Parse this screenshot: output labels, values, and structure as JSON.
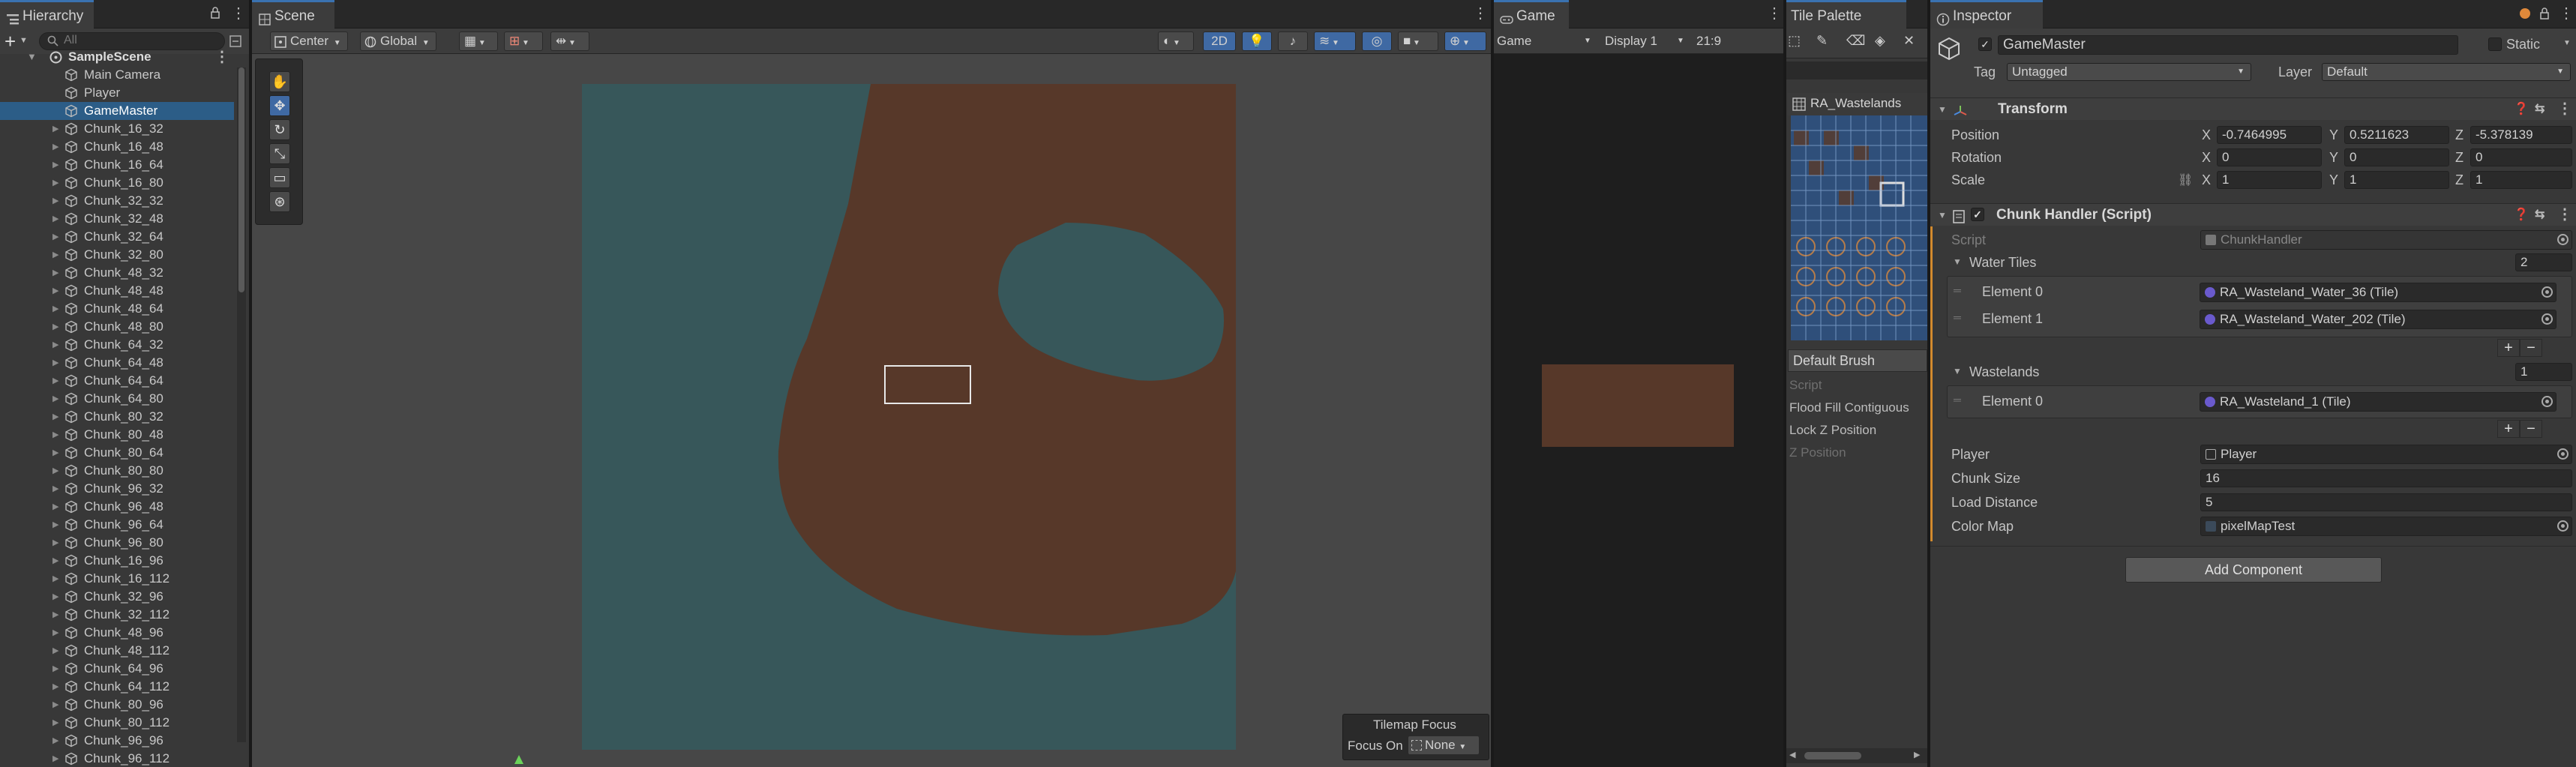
{
  "colors": {
    "accent": "#3f69a3",
    "land": "#573829",
    "water": "#37575a"
  },
  "hierarchy": {
    "tab": "Hierarchy",
    "search_placeholder": "All",
    "scene": "SampleScene",
    "items": [
      {
        "label": "Main Camera",
        "selected": false,
        "arrow": false
      },
      {
        "label": "Player",
        "selected": false,
        "arrow": false
      },
      {
        "label": "GameMaster",
        "selected": true,
        "arrow": false
      },
      {
        "label": "Chunk_16_32",
        "selected": false,
        "arrow": true
      },
      {
        "label": "Chunk_16_48",
        "selected": false,
        "arrow": true
      },
      {
        "label": "Chunk_16_64",
        "selected": false,
        "arrow": true
      },
      {
        "label": "Chunk_16_80",
        "selected": false,
        "arrow": true
      },
      {
        "label": "Chunk_32_32",
        "selected": false,
        "arrow": true
      },
      {
        "label": "Chunk_32_48",
        "selected": false,
        "arrow": true
      },
      {
        "label": "Chunk_32_64",
        "selected": false,
        "arrow": true
      },
      {
        "label": "Chunk_32_80",
        "selected": false,
        "arrow": true
      },
      {
        "label": "Chunk_48_32",
        "selected": false,
        "arrow": true
      },
      {
        "label": "Chunk_48_48",
        "selected": false,
        "arrow": true
      },
      {
        "label": "Chunk_48_64",
        "selected": false,
        "arrow": true
      },
      {
        "label": "Chunk_48_80",
        "selected": false,
        "arrow": true
      },
      {
        "label": "Chunk_64_32",
        "selected": false,
        "arrow": true
      },
      {
        "label": "Chunk_64_48",
        "selected": false,
        "arrow": true
      },
      {
        "label": "Chunk_64_64",
        "selected": false,
        "arrow": true
      },
      {
        "label": "Chunk_64_80",
        "selected": false,
        "arrow": true
      },
      {
        "label": "Chunk_80_32",
        "selected": false,
        "arrow": true
      },
      {
        "label": "Chunk_80_48",
        "selected": false,
        "arrow": true
      },
      {
        "label": "Chunk_80_64",
        "selected": false,
        "arrow": true
      },
      {
        "label": "Chunk_80_80",
        "selected": false,
        "arrow": true
      },
      {
        "label": "Chunk_96_32",
        "selected": false,
        "arrow": true
      },
      {
        "label": "Chunk_96_48",
        "selected": false,
        "arrow": true
      },
      {
        "label": "Chunk_96_64",
        "selected": false,
        "arrow": true
      },
      {
        "label": "Chunk_96_80",
        "selected": false,
        "arrow": true
      },
      {
        "label": "Chunk_16_96",
        "selected": false,
        "arrow": true
      },
      {
        "label": "Chunk_16_112",
        "selected": false,
        "arrow": true
      },
      {
        "label": "Chunk_32_96",
        "selected": false,
        "arrow": true
      },
      {
        "label": "Chunk_32_112",
        "selected": false,
        "arrow": true
      },
      {
        "label": "Chunk_48_96",
        "selected": false,
        "arrow": true
      },
      {
        "label": "Chunk_48_112",
        "selected": false,
        "arrow": true
      },
      {
        "label": "Chunk_64_96",
        "selected": false,
        "arrow": true
      },
      {
        "label": "Chunk_64_112",
        "selected": false,
        "arrow": true
      },
      {
        "label": "Chunk_80_96",
        "selected": false,
        "arrow": true
      },
      {
        "label": "Chunk_80_112",
        "selected": false,
        "arrow": true
      },
      {
        "label": "Chunk_96_96",
        "selected": false,
        "arrow": true
      },
      {
        "label": "Chunk_96_112",
        "selected": false,
        "arrow": true
      }
    ]
  },
  "scene": {
    "tab": "Scene",
    "pivot": "Center",
    "space": "Global",
    "mode_2d": "2D",
    "tilemap_focus": {
      "title": "Tilemap Focus",
      "label": "Focus On",
      "value": "None"
    }
  },
  "game": {
    "tab": "Game",
    "view": "Game",
    "display": "Display 1",
    "aspect": "21:9"
  },
  "palette": {
    "tab": "Tile Palette",
    "palette_name": "RA_Wastelands",
    "brush": "Default Brush",
    "options": [
      {
        "label": "Script",
        "dim": true
      },
      {
        "label": "Flood Fill Contiguous",
        "dim": false
      },
      {
        "label": "Lock Z Position",
        "dim": false
      },
      {
        "label": "Z Position",
        "dim": true
      }
    ]
  },
  "inspector": {
    "tab": "Inspector",
    "object_name": "GameMaster",
    "static_label": "Static",
    "tag_label": "Tag",
    "tag_value": "Untagged",
    "layer_label": "Layer",
    "layer_value": "Default",
    "transform": {
      "title": "Transform",
      "position_label": "Position",
      "position": [
        "-0.7464995",
        "0.5211623",
        "-5.378139"
      ],
      "rotation_label": "Rotation",
      "rotation": [
        "0",
        "0",
        "0"
      ],
      "scale_label": "Scale",
      "scale": [
        "1",
        "1",
        "1"
      ],
      "axis": [
        "X",
        "Y",
        "Z"
      ]
    },
    "chunk_handler": {
      "title": "Chunk Handler (Script)",
      "script_label": "Script",
      "script_value": "ChunkHandler",
      "water_label": "Water Tiles",
      "water_count": "2",
      "water_elements": [
        {
          "label": "Element 0",
          "value": "RA_Wasteland_Water_36 (Tile)"
        },
        {
          "label": "Element 1",
          "value": "RA_Wasteland_Water_202 (Tile)"
        }
      ],
      "wastelands_label": "Wastelands",
      "wastelands_count": "1",
      "wasteland_elements": [
        {
          "label": "Element 0",
          "value": "RA_Wasteland_1 (Tile)"
        }
      ],
      "player_label": "Player",
      "player_value": "Player",
      "chunk_size_label": "Chunk Size",
      "chunk_size": "16",
      "load_distance_label": "Load Distance",
      "load_distance": "5",
      "color_map_label": "Color Map",
      "color_map_value": "pixelMapTest"
    },
    "add_component": "Add Component"
  }
}
